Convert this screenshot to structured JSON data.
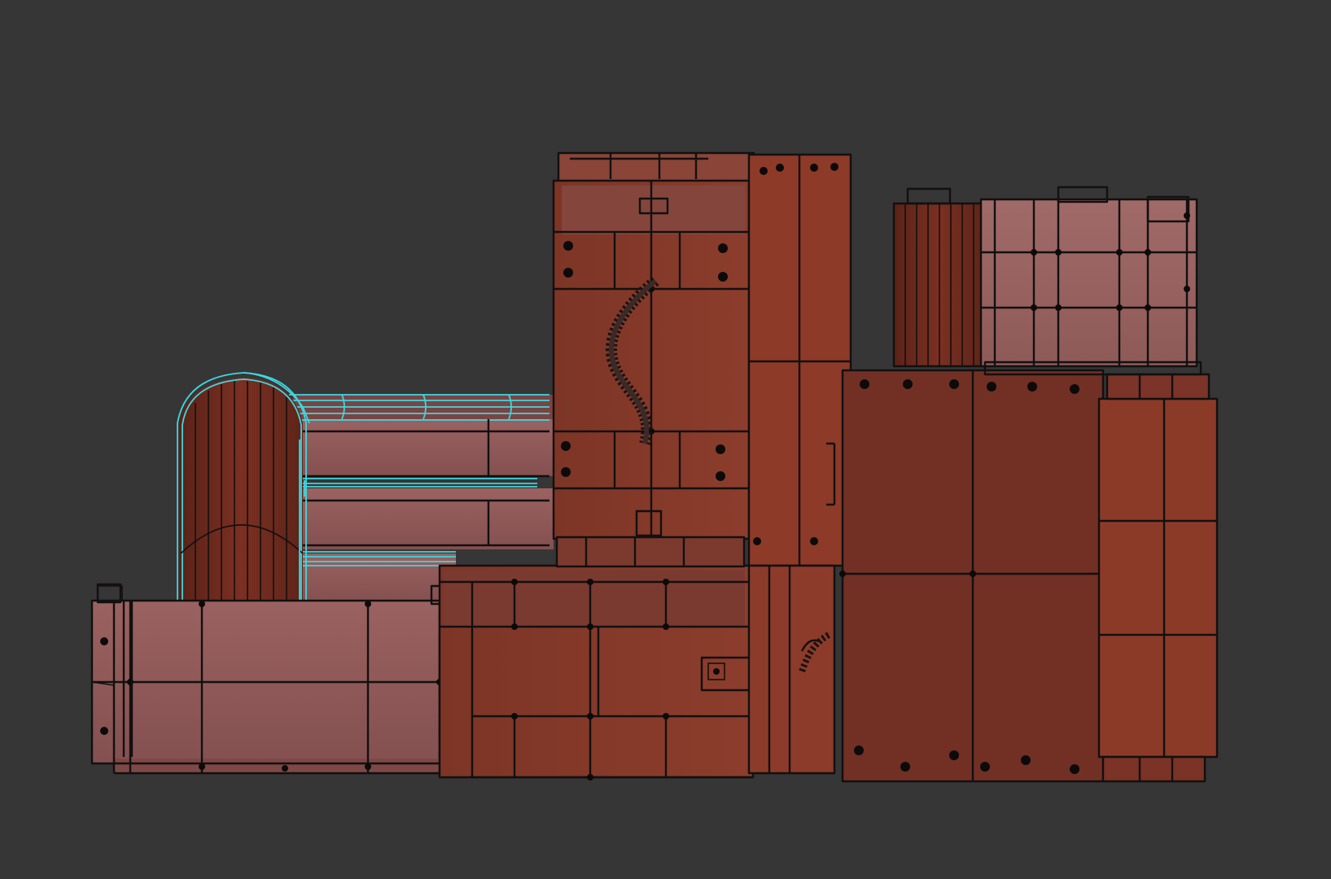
{
  "viewport": {
    "background": "#363636",
    "shading": "wireframe-on-shaded",
    "selection_color": "#3fd6e0"
  },
  "palette": {
    "dark_red": "#6a2a20",
    "mid_red": "#7a3328",
    "rust": "#8b3a2a",
    "pink": "#8a5452",
    "light_pink": "#9a6462",
    "edge": "#121010"
  },
  "objects": [
    {
      "name": "left-bottom-crate"
    },
    {
      "name": "selected-cylinder-tank"
    },
    {
      "name": "center-tall-cabinet"
    },
    {
      "name": "center-low-block"
    },
    {
      "name": "right-large-block"
    },
    {
      "name": "top-right-crate"
    },
    {
      "name": "flexible-cable"
    }
  ]
}
